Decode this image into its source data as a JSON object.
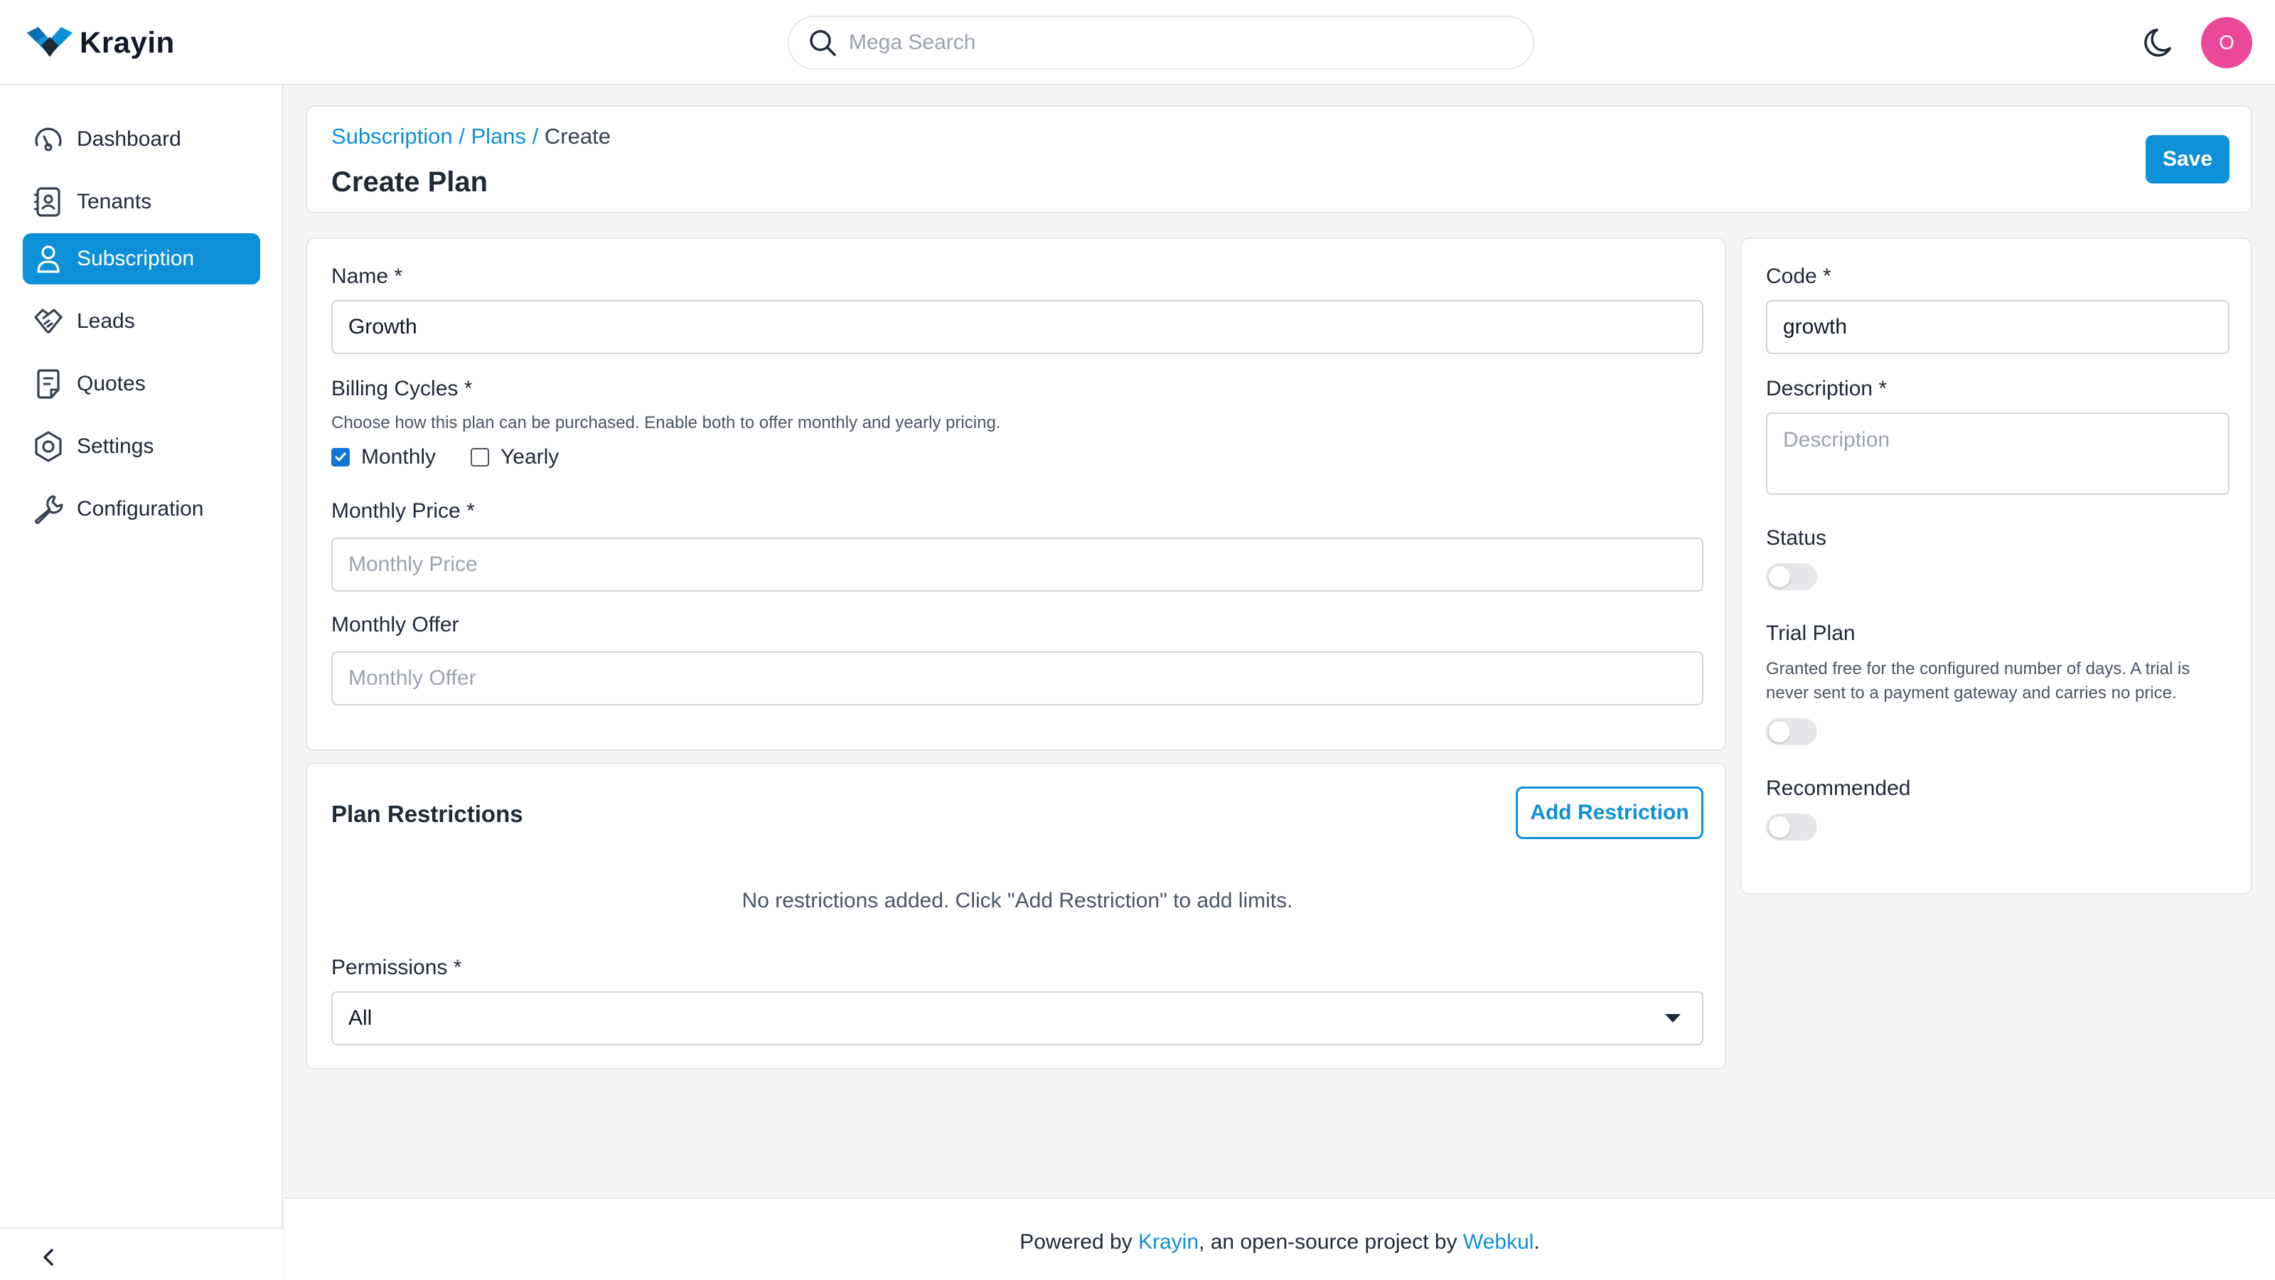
{
  "app": {
    "brand": "Krayin"
  },
  "search": {
    "placeholder": "Mega Search"
  },
  "user": {
    "initial": "O"
  },
  "colors": {
    "primary": "#0e90d9",
    "avatar": "#ec4899"
  },
  "sidebar": {
    "items": [
      {
        "label": "Dashboard",
        "icon": "dashboard-gauge-icon"
      },
      {
        "label": "Tenants",
        "icon": "contact-card-icon"
      },
      {
        "label": "Subscription",
        "icon": "user-icon",
        "active": true
      },
      {
        "label": "Leads",
        "icon": "handshake-icon"
      },
      {
        "label": "Quotes",
        "icon": "document-icon"
      },
      {
        "label": "Settings",
        "icon": "gear-icon"
      },
      {
        "label": "Configuration",
        "icon": "wrench-icon"
      }
    ]
  },
  "page": {
    "breadcrumb": {
      "subscription": "Subscription",
      "plans": "Plans",
      "current": "Create",
      "separator": "/"
    },
    "title": "Create Plan",
    "save_label": "Save"
  },
  "form": {
    "name": {
      "label": "Name *",
      "value": "Growth"
    },
    "billing": {
      "label": "Billing Cycles *",
      "help": "Choose how this plan can be purchased. Enable both to offer monthly and yearly pricing.",
      "monthly": {
        "label": "Monthly",
        "checked": true
      },
      "yearly": {
        "label": "Yearly",
        "checked": false
      }
    },
    "monthly_price": {
      "label": "Monthly Price *",
      "placeholder": "Monthly Price"
    },
    "monthly_offer": {
      "label": "Monthly Offer",
      "placeholder": "Monthly Offer"
    }
  },
  "restrictions": {
    "title": "Plan Restrictions",
    "add_label": "Add Restriction",
    "empty_text": "No restrictions added. Click \"Add Restriction\" to add limits.",
    "permissions": {
      "label": "Permissions *",
      "value": "All"
    }
  },
  "side": {
    "code": {
      "label": "Code *",
      "value": "growth"
    },
    "description": {
      "label": "Description *",
      "placeholder": "Description"
    },
    "status": {
      "label": "Status"
    },
    "trial": {
      "label": "Trial Plan",
      "help": "Granted free for the configured number of days. A trial is never sent to a payment gateway and carries no price."
    },
    "recommended": {
      "label": "Recommended"
    }
  },
  "footer": {
    "prefix": "Powered by ",
    "krayin": "Krayin",
    "middle": ", an open-source project by ",
    "webkul": "Webkul",
    "suffix": "."
  }
}
